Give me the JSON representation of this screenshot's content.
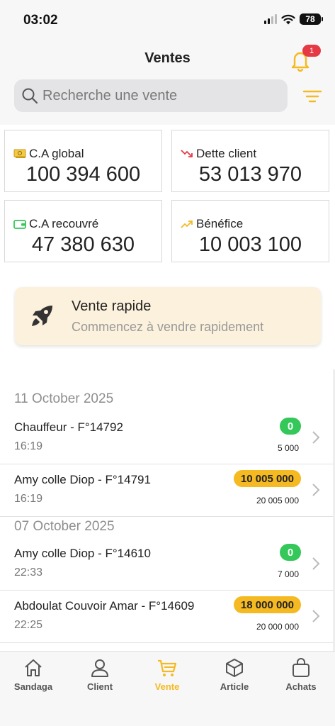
{
  "status_bar": {
    "time": "03:02",
    "battery": "78"
  },
  "header": {
    "title": "Ventes",
    "notification_count": "1"
  },
  "search": {
    "placeholder": "Recherche une vente"
  },
  "stats": [
    {
      "label": "C.A global",
      "value": "100 394 600",
      "icon": "money-icon"
    },
    {
      "label": "Dette client",
      "value": "53 013 970",
      "icon": "trend-down-icon"
    },
    {
      "label": "C.A recouvré",
      "value": "47 380 630",
      "icon": "wallet-icon"
    },
    {
      "label": "Bénéfice",
      "value": "10 003 100",
      "icon": "trend-up-icon"
    }
  ],
  "quick_sale": {
    "title": "Vente rapide",
    "subtitle": "Commencez à vendre rapidement",
    "icon": "rocket-icon"
  },
  "groups": [
    {
      "date": "11 October 2025",
      "sales": [
        {
          "title": "Chauffeur - F°14792",
          "time": "16:19",
          "badge": "0",
          "badge_color": "#34c759",
          "total": "5 000"
        },
        {
          "title": "Amy colle Diop - F°14791",
          "time": "16:19",
          "badge": "10 005 000",
          "badge_color": "#f5b921",
          "total": "20 005 000"
        }
      ]
    },
    {
      "date": "07 October 2025",
      "sales": [
        {
          "title": "Amy colle Diop - F°14610",
          "time": "22:33",
          "badge": "0",
          "badge_color": "#34c759",
          "total": "7 000"
        },
        {
          "title": "Abdoulat Couvoir Amar - F°14609",
          "time": "22:25",
          "badge": "18 000 000",
          "badge_color": "#f5b921",
          "total": "20 000 000"
        }
      ]
    }
  ],
  "tabs": [
    {
      "label": "Sandaga",
      "icon": "home-icon",
      "active": false
    },
    {
      "label": "Client",
      "icon": "person-icon",
      "active": false
    },
    {
      "label": "Vente",
      "icon": "cart-icon",
      "active": true
    },
    {
      "label": "Article",
      "icon": "box-icon",
      "active": false
    },
    {
      "label": "Achats",
      "icon": "bag-icon",
      "active": false
    }
  ],
  "colors": {
    "accent": "#f5b921",
    "success": "#34c759",
    "danger": "#e53945"
  }
}
